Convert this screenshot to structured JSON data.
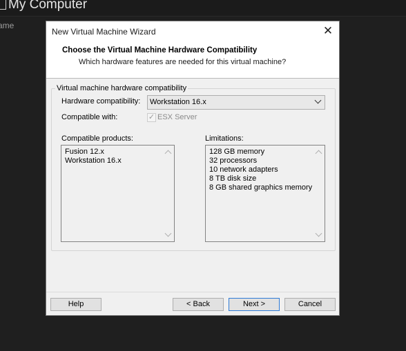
{
  "background_app": {
    "title": "My Computer",
    "side_text": "ame"
  },
  "dialog": {
    "title": "New Virtual Machine Wizard",
    "header_title": "Choose the Virtual Machine Hardware Compatibility",
    "header_subtitle": "Which hardware features are needed for this virtual machine?",
    "group_label": "Virtual machine hardware compatibility",
    "hardware_label": "Hardware compatibility:",
    "hardware_value": "Workstation 16.x",
    "compatible_with_label": "Compatible with:",
    "esx_label": "ESX Server",
    "esx_checked": true,
    "products_label": "Compatible products:",
    "products": [
      "Fusion 12.x",
      "Workstation 16.x"
    ],
    "limitations_label": "Limitations:",
    "limitations": [
      "128 GB memory",
      "32 processors",
      "10 network adapters",
      "8 TB disk size",
      "8 GB shared graphics memory"
    ],
    "buttons": {
      "help": "Help",
      "back": "< Back",
      "next": "Next >",
      "cancel": "Cancel"
    }
  }
}
